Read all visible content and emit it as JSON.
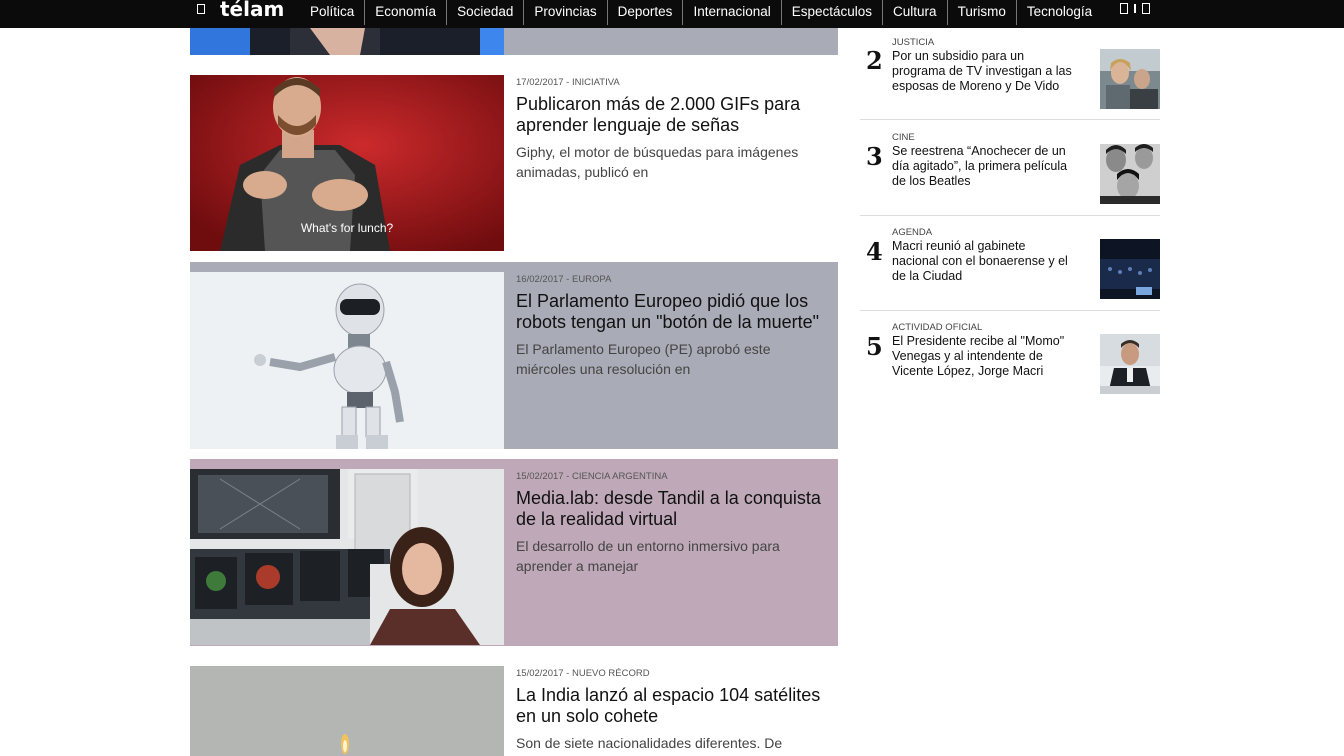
{
  "header": {
    "logo": "télam",
    "nav": [
      "Política",
      "Economía",
      "Sociedad",
      "Provincias",
      "Deportes",
      "Internacional",
      "Espectáculos",
      "Cultura",
      "Turismo",
      "Tecnología"
    ]
  },
  "articles": [
    {
      "meta": "17/02/2017 - INICIATIVA",
      "title": "Publicaron más de 2.000 GIFs para aprender lenguaje de señas",
      "summary": "Giphy, el motor de búsquedas para imágenes animadas, publicó en",
      "image_caption": "What's for lunch?",
      "bg_color": "#ffffff"
    },
    {
      "meta": "16/02/2017 - EUROPA",
      "title": "El Parlamento Europeo pidió que los robots tengan un \"botón de la muerte\"",
      "summary": "El Parlamento Europeo (PE) aprobó este miércoles una resolución en",
      "bg_color": "#a9abb6"
    },
    {
      "meta": "15/02/2017 - CIENCIA ARGENTINA",
      "title": "Media.lab: desde Tandil a la conquista de la realidad virtual",
      "summary": "El desarrollo de un entorno inmersivo para aprender a manejar",
      "bg_color": "#bfa9b9"
    },
    {
      "meta": "15/02/2017 - NUEVO RÉCORD",
      "title": "La India lanzó al espacio 104 satélites en un solo cohete",
      "summary": "Son de siete nacionalidades diferentes. De",
      "bg_color": "#ffffff"
    }
  ],
  "ranking": [
    {
      "num": "2",
      "category": "JUSTICIA",
      "title": "Por un subsidio para un programa de TV investigan a las esposas de Moreno y De Vido"
    },
    {
      "num": "3",
      "category": "CINE",
      "title": "Se reestrena “Anochecer de un día agitado”, la primera película de los Beatles"
    },
    {
      "num": "4",
      "category": "AGENDA",
      "title": "Macri reunió al gabinete nacional con el bonaerense y el de la Ciudad"
    },
    {
      "num": "5",
      "category": "ACTIVIDAD OFICIAL",
      "title": "El Presidente recibe al \"Momo\" Venegas y al intendente de Vicente López, Jorge Macri"
    }
  ]
}
